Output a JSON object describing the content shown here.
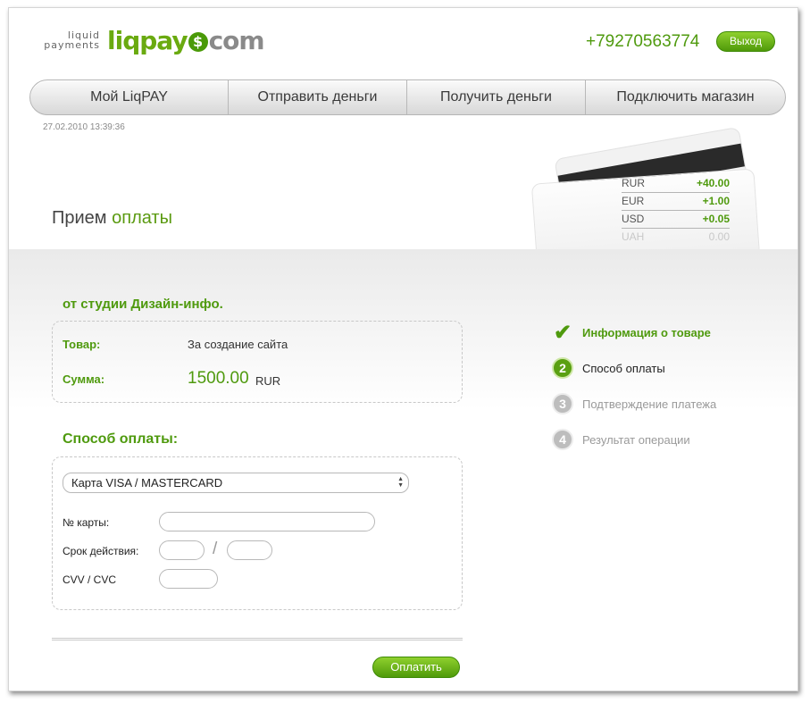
{
  "header": {
    "logo_small_line1": "liquid",
    "logo_small_line2": "payments",
    "logo_big_part1": "liqpay",
    "logo_coin": "$",
    "logo_big_part2": "com",
    "phone": "+79270563774",
    "logout_label": "Выход"
  },
  "nav": {
    "items": [
      {
        "label": "Мой LiqPAY"
      },
      {
        "label": "Отправить деньги"
      },
      {
        "label": "Получить деньги"
      },
      {
        "label": "Подключить магазин"
      }
    ]
  },
  "datetime": "27.02.2010  13:39:36",
  "page_title": {
    "part1": "Прием ",
    "part2": "оплаты"
  },
  "balance": [
    {
      "currency": "RUR",
      "amount": "+40.00"
    },
    {
      "currency": "EUR",
      "amount": "+1.00"
    },
    {
      "currency": "USD",
      "amount": "+0.05"
    },
    {
      "currency": "UAH",
      "amount": "0.00"
    }
  ],
  "order": {
    "from_title": "от студии Дизайн-инфо.",
    "product_label": "Товар:",
    "product_value": "За создание сайта",
    "sum_label": "Сумма:",
    "sum_value": "1500.00",
    "sum_currency": "RUR"
  },
  "payment": {
    "title": "Способ оплаты:",
    "method_selected": "Карта VISA / MASTERCARD",
    "card_number_label": "№ карты:",
    "expiry_label": "Срок действия:",
    "expiry_separator": "/",
    "cvv_label": "CVV / CVC",
    "submit_label": "Оплатить"
  },
  "steps": [
    {
      "number": "✔",
      "label": "Информация о товаре",
      "state": "done"
    },
    {
      "number": "2",
      "label": "Способ оплаты",
      "state": "current"
    },
    {
      "number": "3",
      "label": "Подтверждение платежа",
      "state": "pending"
    },
    {
      "number": "4",
      "label": "Результат операции",
      "state": "pending"
    }
  ],
  "colors": {
    "accent_green": "#4f9a0e",
    "button_green": "#6ab51c"
  }
}
